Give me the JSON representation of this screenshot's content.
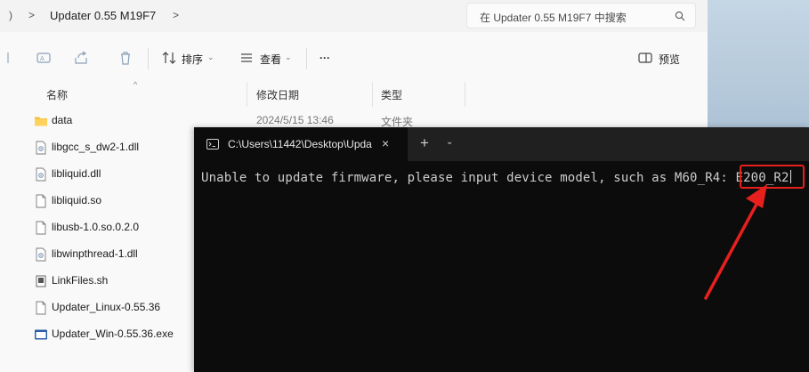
{
  "address_bar": {
    "left_glyph": ")",
    "separator": ">",
    "folder": "Updater 0.55 M19F7",
    "search_placeholder": "在 Updater 0.55 M19F7 中搜索"
  },
  "toolbar": {
    "sort_label": "排序",
    "view_label": "查看",
    "more_label": "···",
    "preview_label": "预览"
  },
  "columns": {
    "name": "名称",
    "date": "修改日期",
    "type": "类型"
  },
  "files": [
    {
      "name": "data",
      "date": "2024/5/15 13:46",
      "type": "文件夹",
      "icon": "folder-icon"
    },
    {
      "name": "libgcc_s_dw2-1.dll",
      "date": "",
      "type": "",
      "icon": "dll-file-icon"
    },
    {
      "name": "libliquid.dll",
      "date": "",
      "type": "",
      "icon": "dll-file-icon"
    },
    {
      "name": "libliquid.so",
      "date": "",
      "type": "",
      "icon": "file-icon"
    },
    {
      "name": "libusb-1.0.so.0.2.0",
      "date": "",
      "type": "",
      "icon": "file-icon"
    },
    {
      "name": "libwinpthread-1.dll",
      "date": "",
      "type": "",
      "icon": "dll-file-icon"
    },
    {
      "name": "LinkFiles.sh",
      "date": "",
      "type": "",
      "icon": "script-file-icon"
    },
    {
      "name": "Updater_Linux-0.55.36",
      "date": "",
      "type": "",
      "icon": "file-icon"
    },
    {
      "name": "Updater_Win-0.55.36.exe",
      "date": "",
      "type": "",
      "icon": "exe-file-icon"
    }
  ],
  "terminal": {
    "tab_title": "C:\\Users\\11442\\Desktop\\Upda",
    "new_tab": "+",
    "close": "×",
    "prompt": "Unable to update firmware, please input device model, such as M60_R4: ",
    "input": "E200_R2"
  },
  "colors": {
    "highlight": "#e8201d",
    "terminal_bg": "#0c0c0c",
    "folder": "#f5c242"
  }
}
